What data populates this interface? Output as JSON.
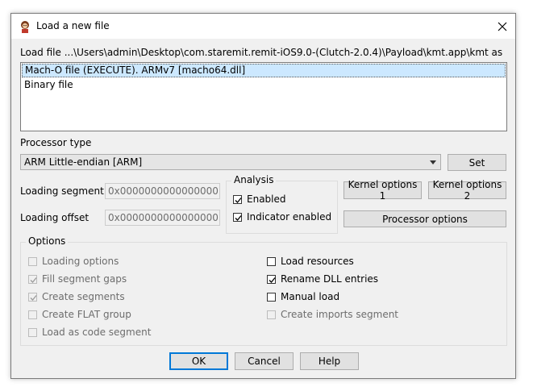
{
  "dialog": {
    "title": "Load a new file",
    "load_file_label": "Load file ...\\Users\\admin\\Desktop\\com.staremit.remit-iOS9.0-(Clutch-2.0.4)\\Payload\\kmt.app\\kmt as",
    "file_types": [
      {
        "label": "Mach-O file (EXECUTE). ARMv7 [macho64.dll]",
        "selected": true
      },
      {
        "label": "Binary file",
        "selected": false
      }
    ],
    "processor_type_label": "Processor type",
    "processor_value": "ARM Little-endian [ARM]",
    "set_button": "Set",
    "loading_segment_label": "Loading segment",
    "loading_segment_value": "0x0000000000000000",
    "loading_offset_label": "Loading offset",
    "loading_offset_value": "0x0000000000000000",
    "analysis": {
      "title": "Analysis",
      "enabled_label": "Enabled",
      "enabled_checked": true,
      "indicator_label": "Indicator enabled",
      "indicator_checked": true
    },
    "kernel_options_1": "Kernel options 1",
    "kernel_options_2": "Kernel options 2",
    "processor_options": "Processor options",
    "options": {
      "title": "Options",
      "left": [
        {
          "label": "Loading options",
          "checked": false,
          "enabled": false
        },
        {
          "label": "Fill segment gaps",
          "checked": true,
          "enabled": false
        },
        {
          "label": "Create segments",
          "checked": true,
          "enabled": false
        },
        {
          "label": "Create FLAT group",
          "checked": false,
          "enabled": false
        },
        {
          "label": "Load as code segment",
          "checked": false,
          "enabled": false
        }
      ],
      "right": [
        {
          "label": "Load resources",
          "checked": false,
          "enabled": true
        },
        {
          "label": "Rename DLL entries",
          "checked": true,
          "enabled": true
        },
        {
          "label": "Manual load",
          "checked": false,
          "enabled": true
        },
        {
          "label": "Create imports segment",
          "checked": false,
          "enabled": false
        }
      ]
    },
    "ok": "OK",
    "cancel": "Cancel",
    "help": "Help"
  }
}
